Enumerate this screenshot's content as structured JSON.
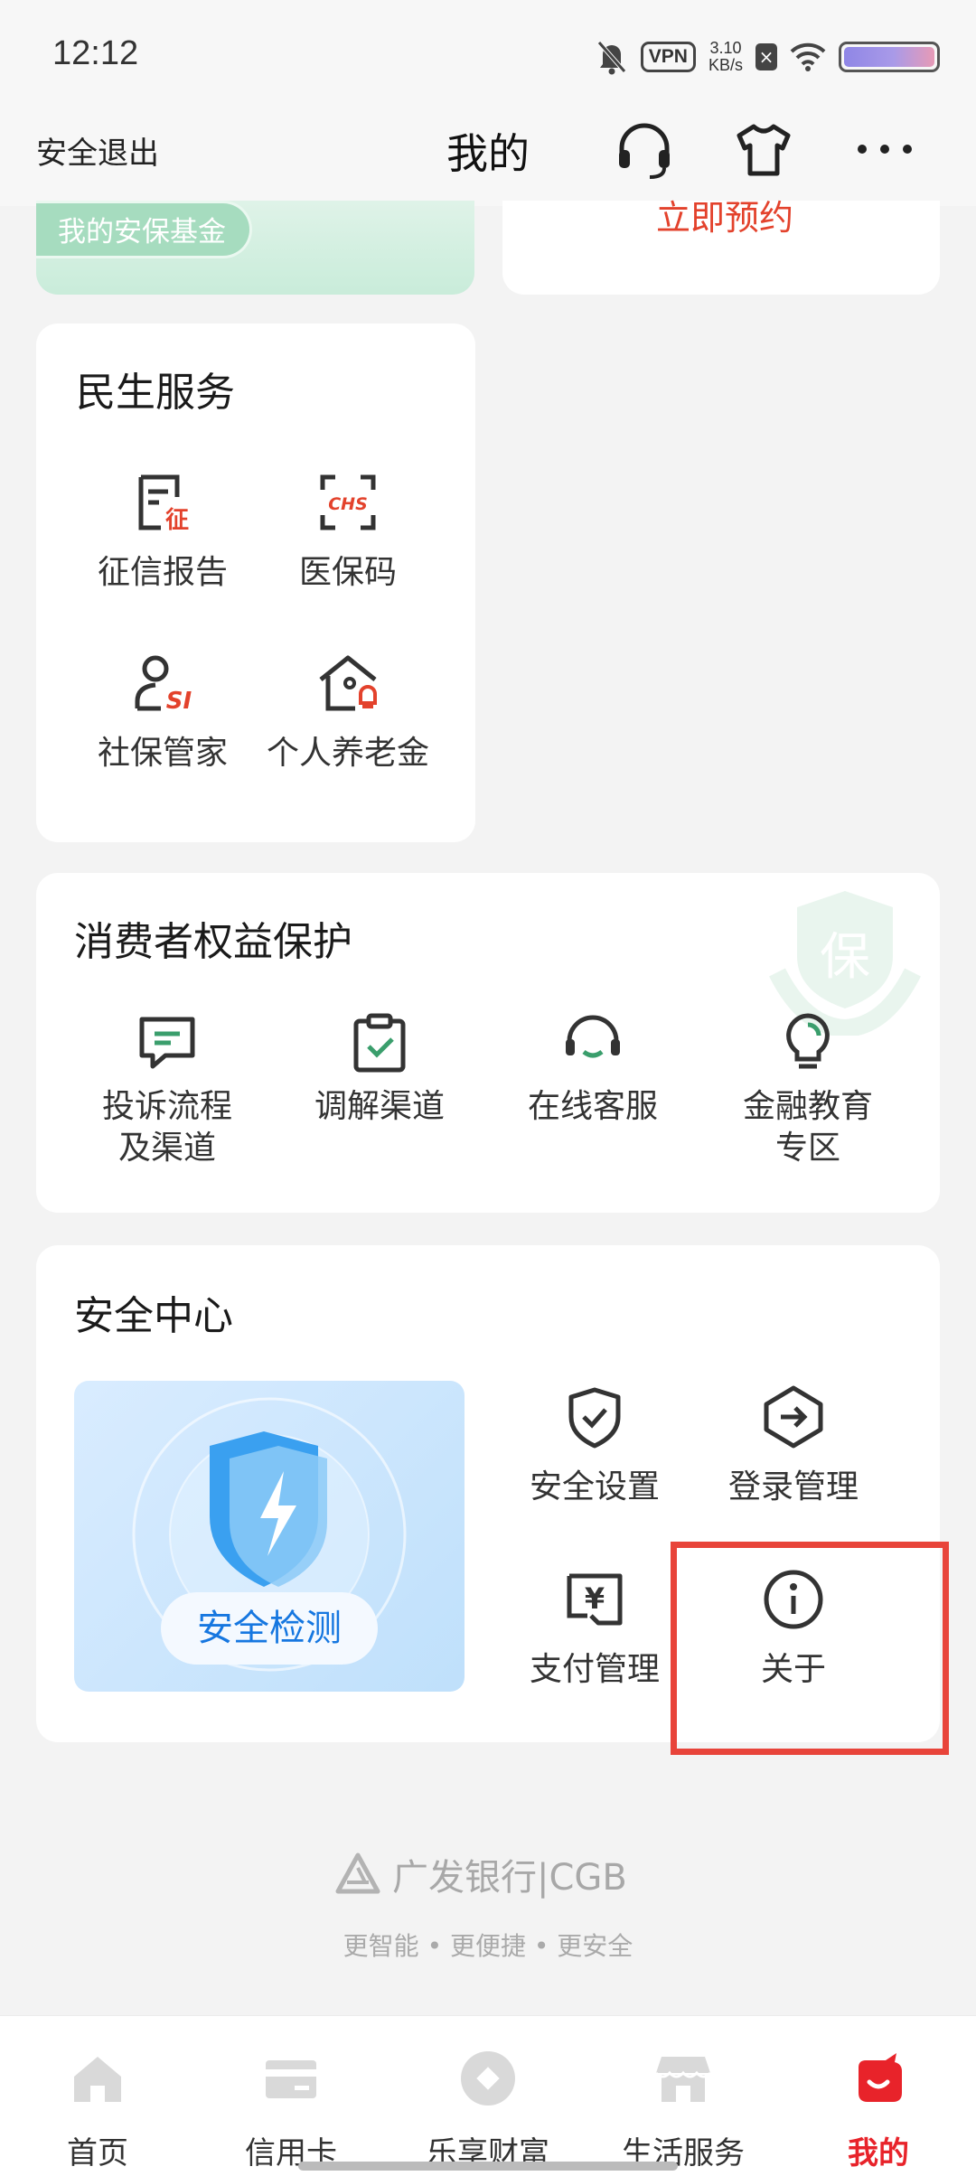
{
  "status_bar": {
    "time": "12:12",
    "vpn": "VPN",
    "speed_value": "3.10",
    "speed_unit": "KB/s"
  },
  "header": {
    "logout": "安全退出",
    "title": "我的",
    "icons": [
      "headset-icon",
      "tshirt-icon",
      "more-icon"
    ]
  },
  "top_cards": {
    "fund_label": "我的安保基金",
    "appointment_label": "立即预约"
  },
  "livelihood": {
    "title": "民生服务",
    "items": [
      {
        "label": "征信报告",
        "icon": "credit-report-icon",
        "badge": "征"
      },
      {
        "label": "医保码",
        "icon": "medical-insurance-code-icon",
        "badge": "CHS"
      },
      {
        "label": "社保管家",
        "icon": "social-security-icon",
        "badge": "SI"
      },
      {
        "label": "个人养老金",
        "icon": "pension-icon"
      }
    ]
  },
  "consumer": {
    "title": "消费者权益保护",
    "watermark": "保",
    "items": [
      {
        "label_1": "投诉流程",
        "label_2": "及渠道",
        "icon": "complaint-icon"
      },
      {
        "label_1": "调解渠道",
        "icon": "mediation-icon"
      },
      {
        "label_1": "在线客服",
        "icon": "online-service-icon"
      },
      {
        "label_1": "金融教育",
        "label_2": "专区",
        "icon": "finance-education-icon"
      }
    ]
  },
  "security": {
    "title": "安全中心",
    "banner_button": "安全检测",
    "items": [
      {
        "label": "安全设置",
        "icon": "shield-check-icon"
      },
      {
        "label": "登录管理",
        "icon": "login-icon"
      },
      {
        "label": "支付管理",
        "icon": "yuan-icon",
        "glyph": "¥"
      },
      {
        "label": "关于",
        "icon": "info-icon"
      }
    ]
  },
  "footer": {
    "logo_text": "广发银行|CGB",
    "slogan": "更智能 • 更便捷 • 更安全"
  },
  "bottom_nav": [
    {
      "label": "首页",
      "icon": "home-icon"
    },
    {
      "label": "信用卡",
      "icon": "credit-card-icon"
    },
    {
      "label": "乐享财富",
      "icon": "wealth-icon"
    },
    {
      "label": "生活服务",
      "icon": "store-icon"
    },
    {
      "label": "我的",
      "icon": "my-icon",
      "active": true
    }
  ],
  "colors": {
    "accent_red": "#e3422c",
    "green": "#3a9e6c",
    "highlight_box": "#e8443a",
    "nav_active": "#e8232a"
  }
}
